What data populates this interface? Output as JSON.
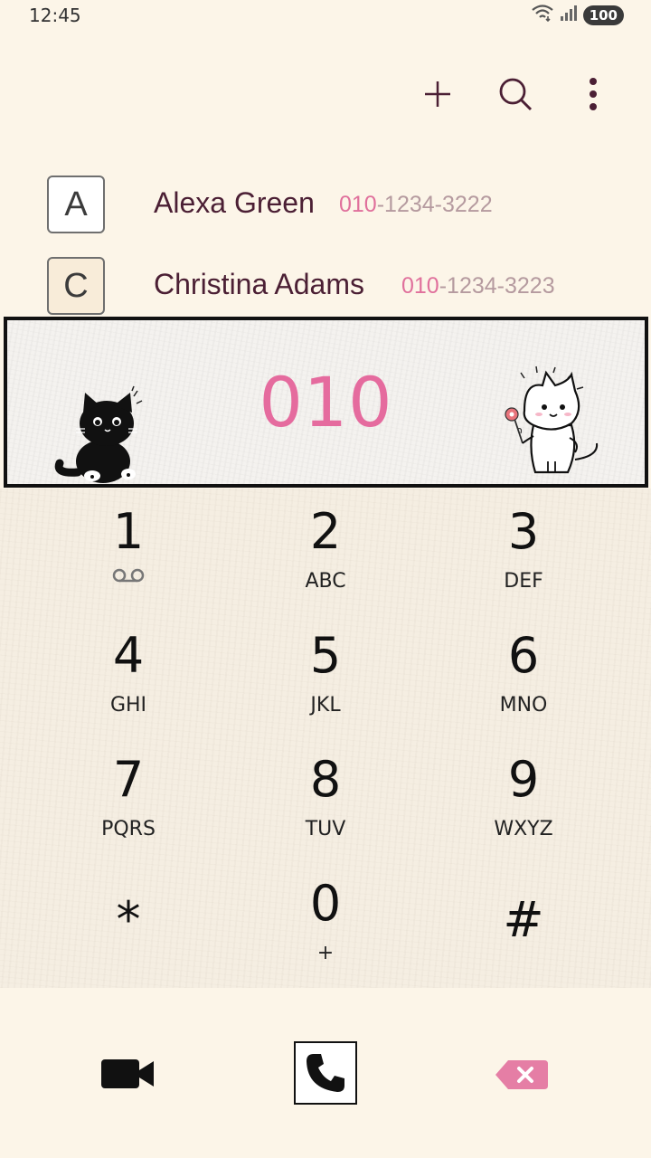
{
  "status_bar": {
    "time": "12:45",
    "battery": "100",
    "icons": [
      "wifi-icon",
      "signal-icon",
      "battery-icon"
    ]
  },
  "toolbar": {
    "icons": [
      "add-icon",
      "search-icon",
      "more-vert-icon"
    ]
  },
  "contacts": [
    {
      "index_letter": "A",
      "name": "Alexa Green",
      "phone_prefix": "010",
      "phone_rest": "-1234-3222"
    },
    {
      "index_letter": "C",
      "name": "Christina Adams",
      "phone_prefix": "010",
      "phone_rest": "-1234-3223"
    }
  ],
  "dialer": {
    "entered_number": "010"
  },
  "keypad": {
    "keys": [
      {
        "digit": "1",
        "letters": ""
      },
      {
        "digit": "2",
        "letters": "ABC"
      },
      {
        "digit": "3",
        "letters": "DEF"
      },
      {
        "digit": "4",
        "letters": "GHI"
      },
      {
        "digit": "5",
        "letters": "JKL"
      },
      {
        "digit": "6",
        "letters": "MNO"
      },
      {
        "digit": "7",
        "letters": "PQRS"
      },
      {
        "digit": "8",
        "letters": "TUV"
      },
      {
        "digit": "9",
        "letters": "WXYZ"
      },
      {
        "digit": "*",
        "letters": ""
      },
      {
        "digit": "0",
        "letters": "+"
      },
      {
        "digit": "#",
        "letters": ""
      }
    ]
  },
  "bottom_bar": {
    "icons": [
      "video-call-icon",
      "call-icon",
      "backspace-icon"
    ]
  },
  "colors": {
    "accent_pink": "#e56b9e",
    "name_text": "#4b1f34",
    "phone_text": "#b59a9f",
    "background": "#fcf5e8"
  }
}
